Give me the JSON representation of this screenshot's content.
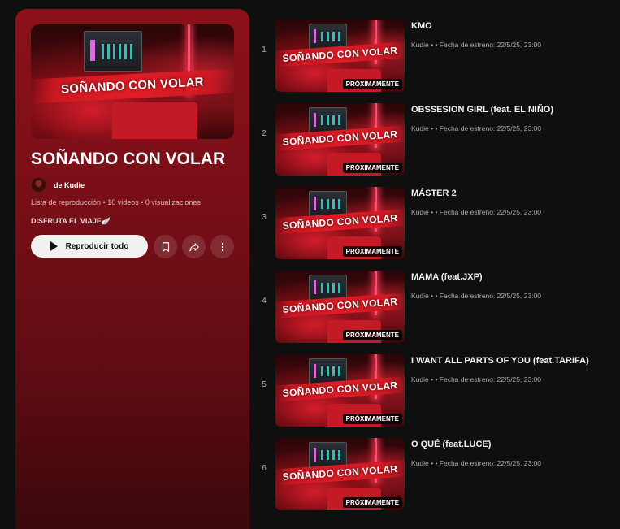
{
  "playlist": {
    "title": "SOÑANDO CON VOLAR",
    "thumbnail_text": "SOÑANDO CON VOLAR",
    "owner": "de Kudie",
    "meta": "Lista de reproducción • 10 videos • 0 visualizaciones",
    "description": "DISFRUTA EL VIAJE🪽",
    "play_all_label": "Reproducir todo",
    "accent_color": "#8c1019"
  },
  "videos": [
    {
      "index": "1",
      "title": "KMO",
      "meta": "Kudie •  • Fecha de estreno: 22/5/25, 23:00",
      "badge": "PRÓXIMAMENTE",
      "thumb_text": "SOÑANDO CON VOLAR"
    },
    {
      "index": "2",
      "title": "OBSSESION GIRL (feat. EL NIÑO)",
      "meta": "Kudie •  • Fecha de estreno: 22/5/25, 23:00",
      "badge": "PRÓXIMAMENTE",
      "thumb_text": "SOÑANDO CON VOLAR"
    },
    {
      "index": "3",
      "title": "MÁSTER 2",
      "meta": "Kudie •  • Fecha de estreno: 22/5/25, 23:00",
      "badge": "PRÓXIMAMENTE",
      "thumb_text": "SOÑANDO CON VOLAR"
    },
    {
      "index": "4",
      "title": "MAMA (feat.JXP)",
      "meta": "Kudie •  • Fecha de estreno: 22/5/25, 23:00",
      "badge": "PRÓXIMAMENTE",
      "thumb_text": "SOÑANDO CON VOLAR"
    },
    {
      "index": "5",
      "title": "I WANT ALL PARTS OF YOU (feat.TARIFA)",
      "meta": "Kudie •  • Fecha de estreno: 22/5/25, 23:00",
      "badge": "PRÓXIMAMENTE",
      "thumb_text": "SOÑANDO CON VOLAR"
    },
    {
      "index": "6",
      "title": "O QUÉ (feat.LUCE)",
      "meta": "Kudie •  • Fecha de estreno: 22/5/25, 23:00",
      "badge": "PRÓXIMAMENTE",
      "thumb_text": "SOÑANDO CON VOLAR"
    }
  ],
  "icons": {
    "save": "bookmark-icon",
    "share": "share-icon",
    "more": "more-vert-icon",
    "play": "play-icon"
  }
}
